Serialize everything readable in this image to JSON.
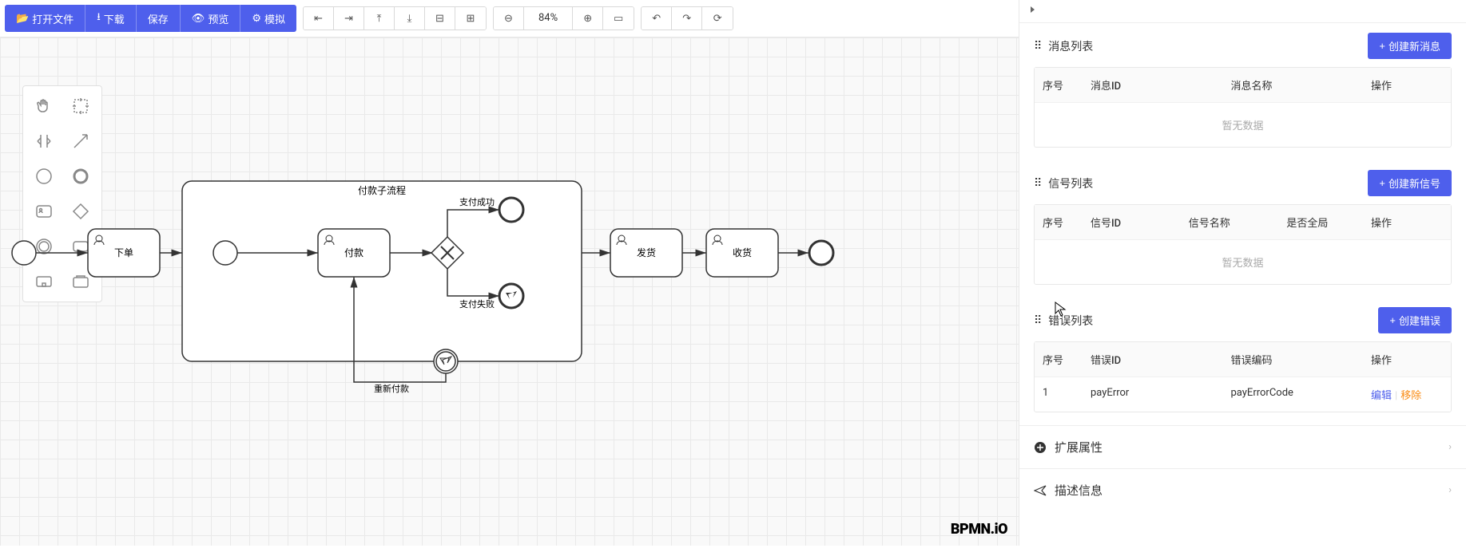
{
  "toolbar": {
    "open": "打开文件",
    "download": "下载",
    "save": "保存",
    "preview": "预览",
    "simulate": "模拟"
  },
  "zoom": {
    "percent": "84%"
  },
  "diagram": {
    "subprocess_title": "付款子流程",
    "task_order": "下单",
    "task_pay": "付款",
    "task_ship": "发货",
    "task_receive": "收货",
    "label_success": "支付成功",
    "label_fail": "支付失败",
    "label_retry": "重新付款"
  },
  "logo": "BPMN.iO",
  "panel": {
    "messages": {
      "title": "消息列表",
      "add": "创建新消息",
      "cols": {
        "idx": "序号",
        "id": "消息ID",
        "name": "消息名称",
        "op": "操作"
      },
      "empty": "暂无数据"
    },
    "signals": {
      "title": "信号列表",
      "add": "创建新信号",
      "cols": {
        "idx": "序号",
        "id": "信号ID",
        "name": "信号名称",
        "global": "是否全局",
        "op": "操作"
      },
      "empty": "暂无数据"
    },
    "errors": {
      "title": "错误列表",
      "add": "创建错误",
      "cols": {
        "idx": "序号",
        "id": "错误ID",
        "code": "错误编码",
        "op": "操作"
      },
      "rows": [
        {
          "idx": "1",
          "id": "payError",
          "code": "payErrorCode"
        }
      ],
      "edit": "编辑",
      "remove": "移除"
    },
    "acc_ext": "扩展属性",
    "acc_desc": "描述信息"
  }
}
